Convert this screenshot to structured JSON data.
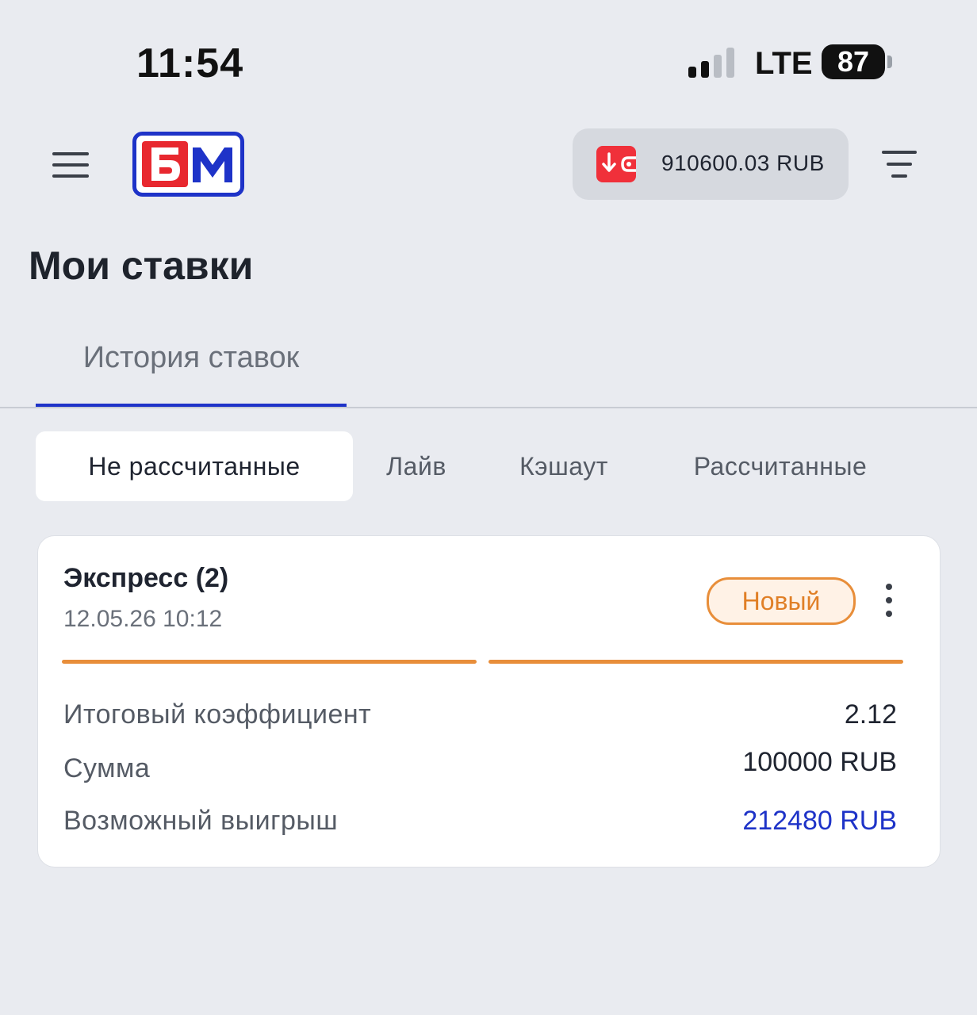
{
  "status_bar": {
    "time": "11:54",
    "network": "LTE",
    "battery": "87"
  },
  "header": {
    "logo": "БМ",
    "balance": "910600.03 RUB"
  },
  "page": {
    "title": "Мои ставки"
  },
  "tabs": {
    "history_label": "История ставок"
  },
  "filters": [
    {
      "label": "Не рассчитанные",
      "active": true
    },
    {
      "label": "Лайв",
      "active": false
    },
    {
      "label": "Кэшаут",
      "active": false
    },
    {
      "label": "Рассчитанные",
      "active": false
    }
  ],
  "bet": {
    "title": "Экспресс (2)",
    "date": "12.05.26 10:12",
    "status": "Новый",
    "rows": [
      {
        "label": "Итоговый коэффициент",
        "value": "2.12"
      },
      {
        "label": "Сумма",
        "value": "100000 RUB"
      },
      {
        "label": "Возможный выигрыш",
        "value": "212480 RUB"
      }
    ]
  },
  "colors": {
    "accent_blue": "#1e33c8",
    "status_orange": "#e88e3a",
    "logo_red": "#e8282f",
    "wallet_red": "#f0303a",
    "background": "#e9ebf0"
  },
  "icons": {
    "menu": "hamburger-icon",
    "wallet": "wallet-deposit-icon",
    "filter": "filter-icon",
    "more": "kebab-icon"
  }
}
